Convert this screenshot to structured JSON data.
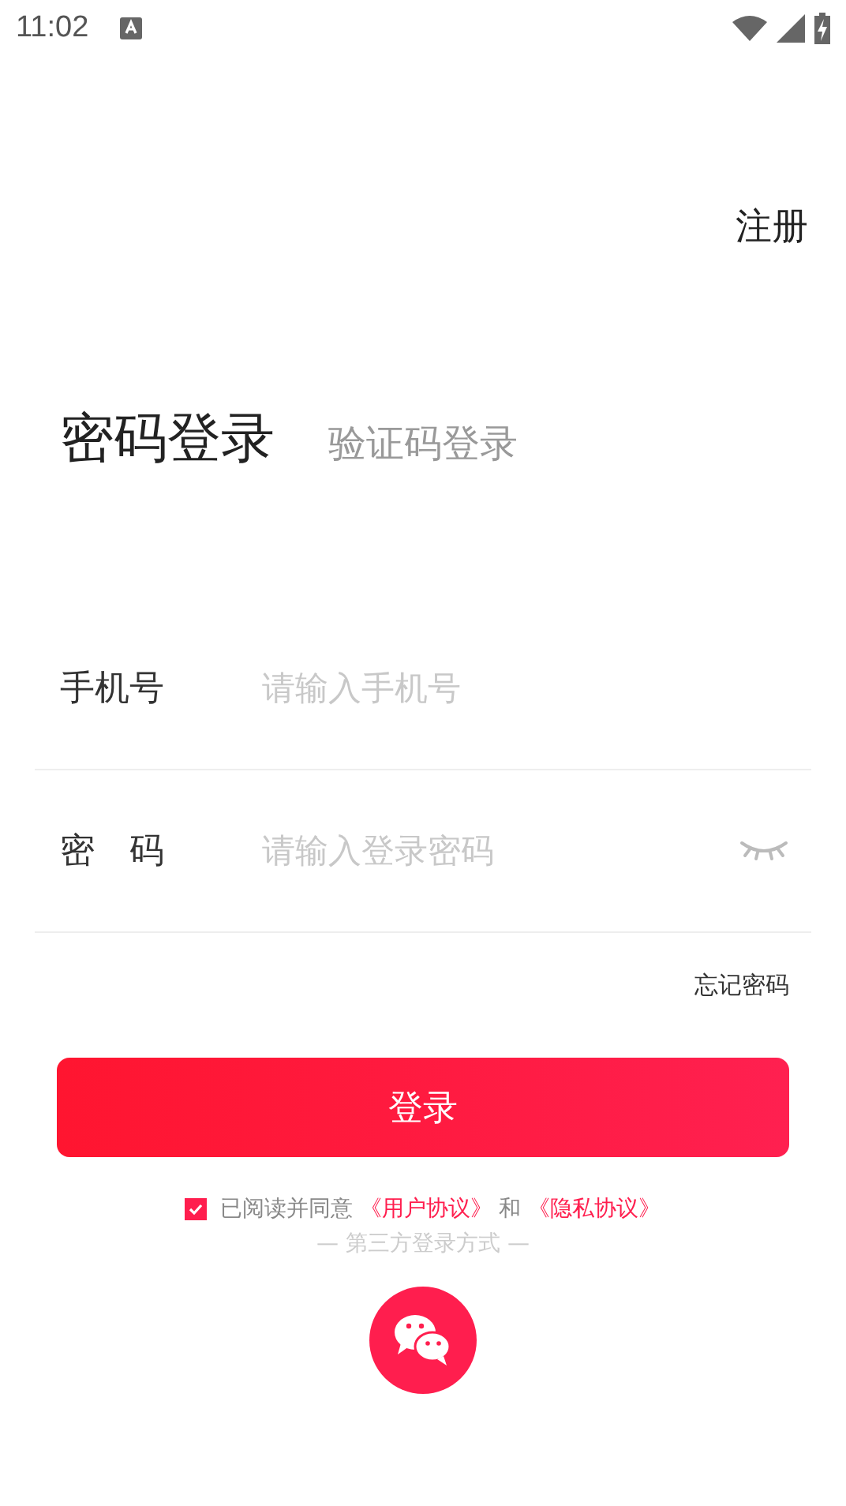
{
  "status_bar": {
    "time": "11:02"
  },
  "header": {
    "register": "注册"
  },
  "tabs": [
    {
      "label": "密码登录",
      "selected": true
    },
    {
      "label": "验证码登录",
      "selected": false
    }
  ],
  "fields": [
    {
      "kind": "phone",
      "label": "手机号",
      "placeholder": "请输入手机号"
    },
    {
      "kind": "password",
      "label": "密　码",
      "placeholder": "请输入登录密码"
    }
  ],
  "forgot_password": "忘记密码",
  "login_button": "登录",
  "agreement": {
    "checked": true,
    "prefix": "已阅读并同意",
    "terms_link": "《用户协议》",
    "conjunction": "和",
    "privacy_link": "《隐私协议》"
  },
  "third_party": {
    "title": "— 第三方登录方式 —"
  }
}
